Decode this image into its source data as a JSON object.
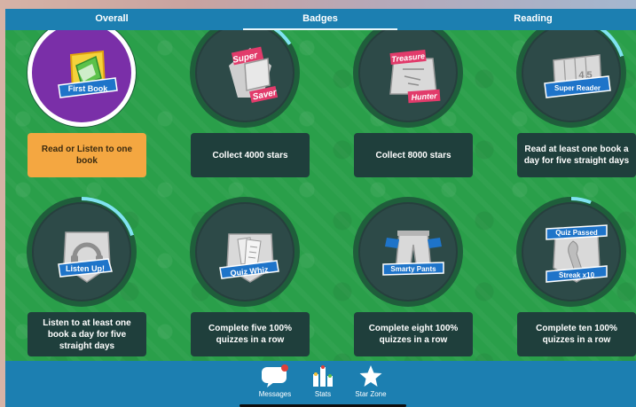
{
  "topnav": {
    "tabs": [
      {
        "label": "Overall"
      },
      {
        "label": "Badges",
        "active": true
      },
      {
        "label": "Reading"
      }
    ]
  },
  "badges": [
    {
      "name": "first-book",
      "emblem_text": "First Book",
      "description": "Read or Listen to one book",
      "earned": true,
      "progress": 1.0
    },
    {
      "name": "super-saver",
      "emblem_text_1": "Super",
      "emblem_text_2": "Saver",
      "description": "Collect 4000 stars",
      "earned": false,
      "progress": 0.15
    },
    {
      "name": "treasure-hunter",
      "emblem_text_1": "Treasure",
      "emblem_text_2": "Hunter",
      "description": "Collect 8000 stars",
      "earned": false,
      "progress": 0.0
    },
    {
      "name": "super-reader",
      "emblem_text": "Super Reader",
      "emblem_detail": "4 5",
      "description": "Read at least one book a day for five straight days",
      "earned": false,
      "progress": 0.2
    },
    {
      "name": "listen-up",
      "emblem_text": "Listen Up!",
      "description": "Listen to at least one book a day for five straight days",
      "earned": false,
      "progress": 0.2
    },
    {
      "name": "quiz-whiz",
      "emblem_text": "Quiz Whiz",
      "description": "Complete five 100% quizzes in a row",
      "earned": false,
      "progress": 0.0
    },
    {
      "name": "smarty-pants",
      "emblem_text": "Smarty Pants",
      "description": "Complete eight 100% quizzes in a row",
      "earned": false,
      "progress": 0.0
    },
    {
      "name": "quiz-passed-streak",
      "emblem_text_1": "Quiz Passed",
      "emblem_text_2": "Streak x10",
      "description": "Complete ten 100% quizzes in a row",
      "earned": false,
      "progress": 0.05
    }
  ],
  "bottombar": {
    "items": [
      {
        "label": "Messages",
        "icon": "messages-icon",
        "has_notification": true
      },
      {
        "label": "Stats",
        "icon": "stats-icon"
      },
      {
        "label": "Star Zone",
        "icon": "star-icon"
      }
    ]
  },
  "colors": {
    "nav_blue": "#1c7fb1",
    "field_green": "#2a9f4a",
    "badge_dark": "#2d4a48",
    "earned_purple": "#7a2fa8",
    "earned_orange": "#f4a741",
    "progress_cyan": "#7fe3f0"
  }
}
